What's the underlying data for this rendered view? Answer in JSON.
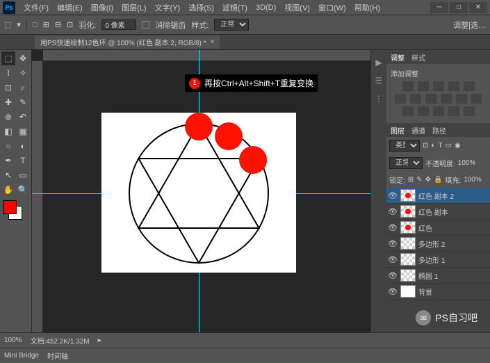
{
  "menubar": {
    "items": [
      "文件(F)",
      "编辑(E)",
      "图像(I)",
      "图层(L)",
      "文字(Y)",
      "选择(S)",
      "滤镜(T)",
      "3D(D)",
      "视图(V)",
      "窗口(W)",
      "帮助(H)"
    ]
  },
  "optionsbar": {
    "feather_label": "羽化:",
    "feather_value": "0 像素",
    "antialias": "消除锯齿",
    "style_label": "样式:",
    "style_value": "正常",
    "refine": "调整|选…"
  },
  "document_tab": "用PS快速绘制12色环 @ 100% (红色 副本 2, RGB/8) *",
  "annotation": {
    "num": "1",
    "text": "再按Ctrl+Alt+Shift+T重复变换"
  },
  "adjustments": {
    "tab1": "调整",
    "tab2": "样式",
    "title": "添加调整"
  },
  "layers": {
    "tab1": "图层",
    "tab2": "通道",
    "tab3": "路径",
    "filter": "类型",
    "blend": "正常",
    "opacity_label": "不透明度:",
    "opacity": "100%",
    "lock_label": "锁定:",
    "fill_label": "填充:",
    "fill": "100%",
    "rows": [
      {
        "name": "红色 副本 2",
        "sel": true,
        "dot": true
      },
      {
        "name": "红色 副本",
        "sel": false,
        "dot": true
      },
      {
        "name": "红色",
        "sel": false,
        "dot": true
      },
      {
        "name": "多边形 2",
        "sel": false,
        "dot": false
      },
      {
        "name": "多边形 1",
        "sel": false,
        "dot": false
      },
      {
        "name": "椭圆 1",
        "sel": false,
        "dot": false
      },
      {
        "name": "背景",
        "sel": false,
        "white": true
      }
    ]
  },
  "status": {
    "zoom": "100%",
    "mini": "Mini Bridge",
    "timeline": "时间轴",
    "docinfo": "文档:452.2K/1.32M"
  },
  "watermark": "PS自习吧",
  "chart_data": {
    "type": "diagram",
    "description": "Black circle with inscribed hexagram (two overlapping triangles) inside a white canvas with cyan guides. Three red filled circles positioned at top and upper-right portion of main circle."
  }
}
